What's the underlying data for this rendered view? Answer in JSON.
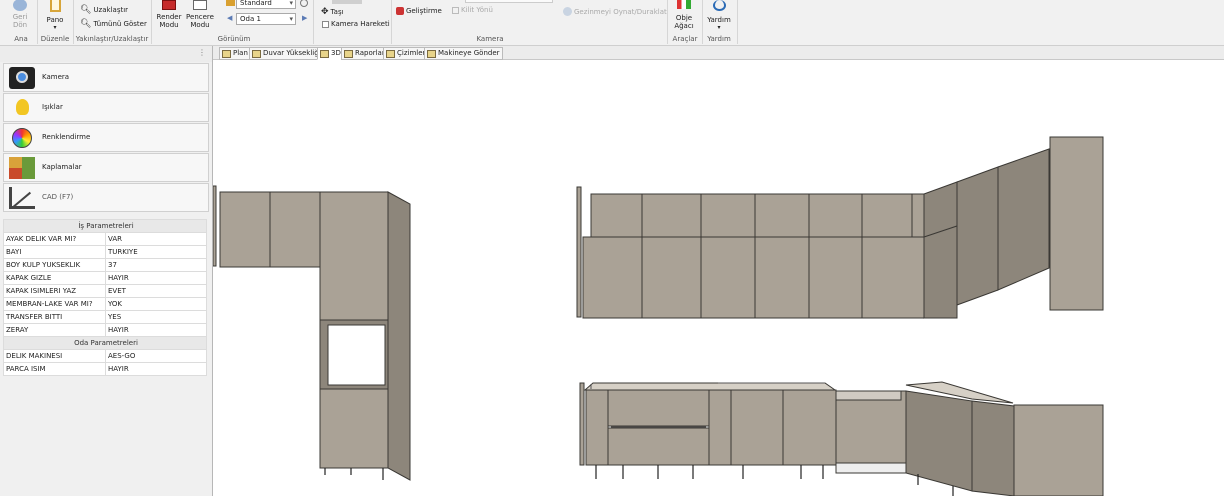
{
  "ribbon": {
    "ana": {
      "btn": "Geri\nDön",
      "group": "Ana"
    },
    "duzenle": {
      "btn": "Pano",
      "group": "Düzenle"
    },
    "yakin": {
      "zoom_out": "Uzaklaştır",
      "show_all": "Tümünü Göster",
      "group": "Yakınlaştır/Uzaklaştır"
    },
    "gorunum": {
      "render": "Render\nModu",
      "pencere": "Pencere\nModu",
      "style_value": "Standard",
      "room_value": "Oda 1",
      "group": "Görünüm"
    },
    "kamera": {
      "tasi": "Taşı",
      "kamera_hareketi": "Kamera Hareketi",
      "gelistirme": "Geliştirme",
      "kilit_yonu": "Kilit Yönü",
      "gezinme": "Gezinmeyi Oynat/Duraklat",
      "group": "Kamera"
    },
    "araclar": {
      "btn": "Obje\nAğacı",
      "group": "Araçlar"
    },
    "yardim": {
      "btn": "Yardım",
      "group": "Yardım"
    }
  },
  "tabs": [
    "Plan",
    "Duvar Yüksekliği",
    "3D",
    "Raporlar",
    "Çizimler",
    "Makineye Gönder"
  ],
  "active_tab": "3D",
  "left_tools": [
    "Kamera",
    "Işıklar",
    "Renklendirme",
    "Kaplamalar",
    "CAD (F7)"
  ],
  "is_params": {
    "title": "İş Parametreleri",
    "rows": [
      [
        "AYAK DELIK VAR MI?",
        "VAR"
      ],
      [
        "BAYI",
        "TURKIYE"
      ],
      [
        "BOY KULP YUKSEKLIK",
        "37"
      ],
      [
        "KAPAK GIZLE",
        "HAYIR"
      ],
      [
        "KAPAK ISIMLERI YAZ",
        "EVET"
      ],
      [
        "MEMBRAN-LAKE VAR MI?",
        "YOK"
      ],
      [
        "TRANSFER BITTI",
        "YES"
      ],
      [
        "ZERAY",
        "HAYIR"
      ]
    ]
  },
  "oda_params": {
    "title": "Oda Parametreleri",
    "rows": [
      [
        "DELIK MAKINESI",
        "AES-GO"
      ],
      [
        "PARCA ISIM",
        "HAYIR"
      ]
    ]
  },
  "colors": {
    "cabinet": "#aaa296",
    "cabinet_dark": "#8d867b",
    "edge": "#3a3834"
  }
}
